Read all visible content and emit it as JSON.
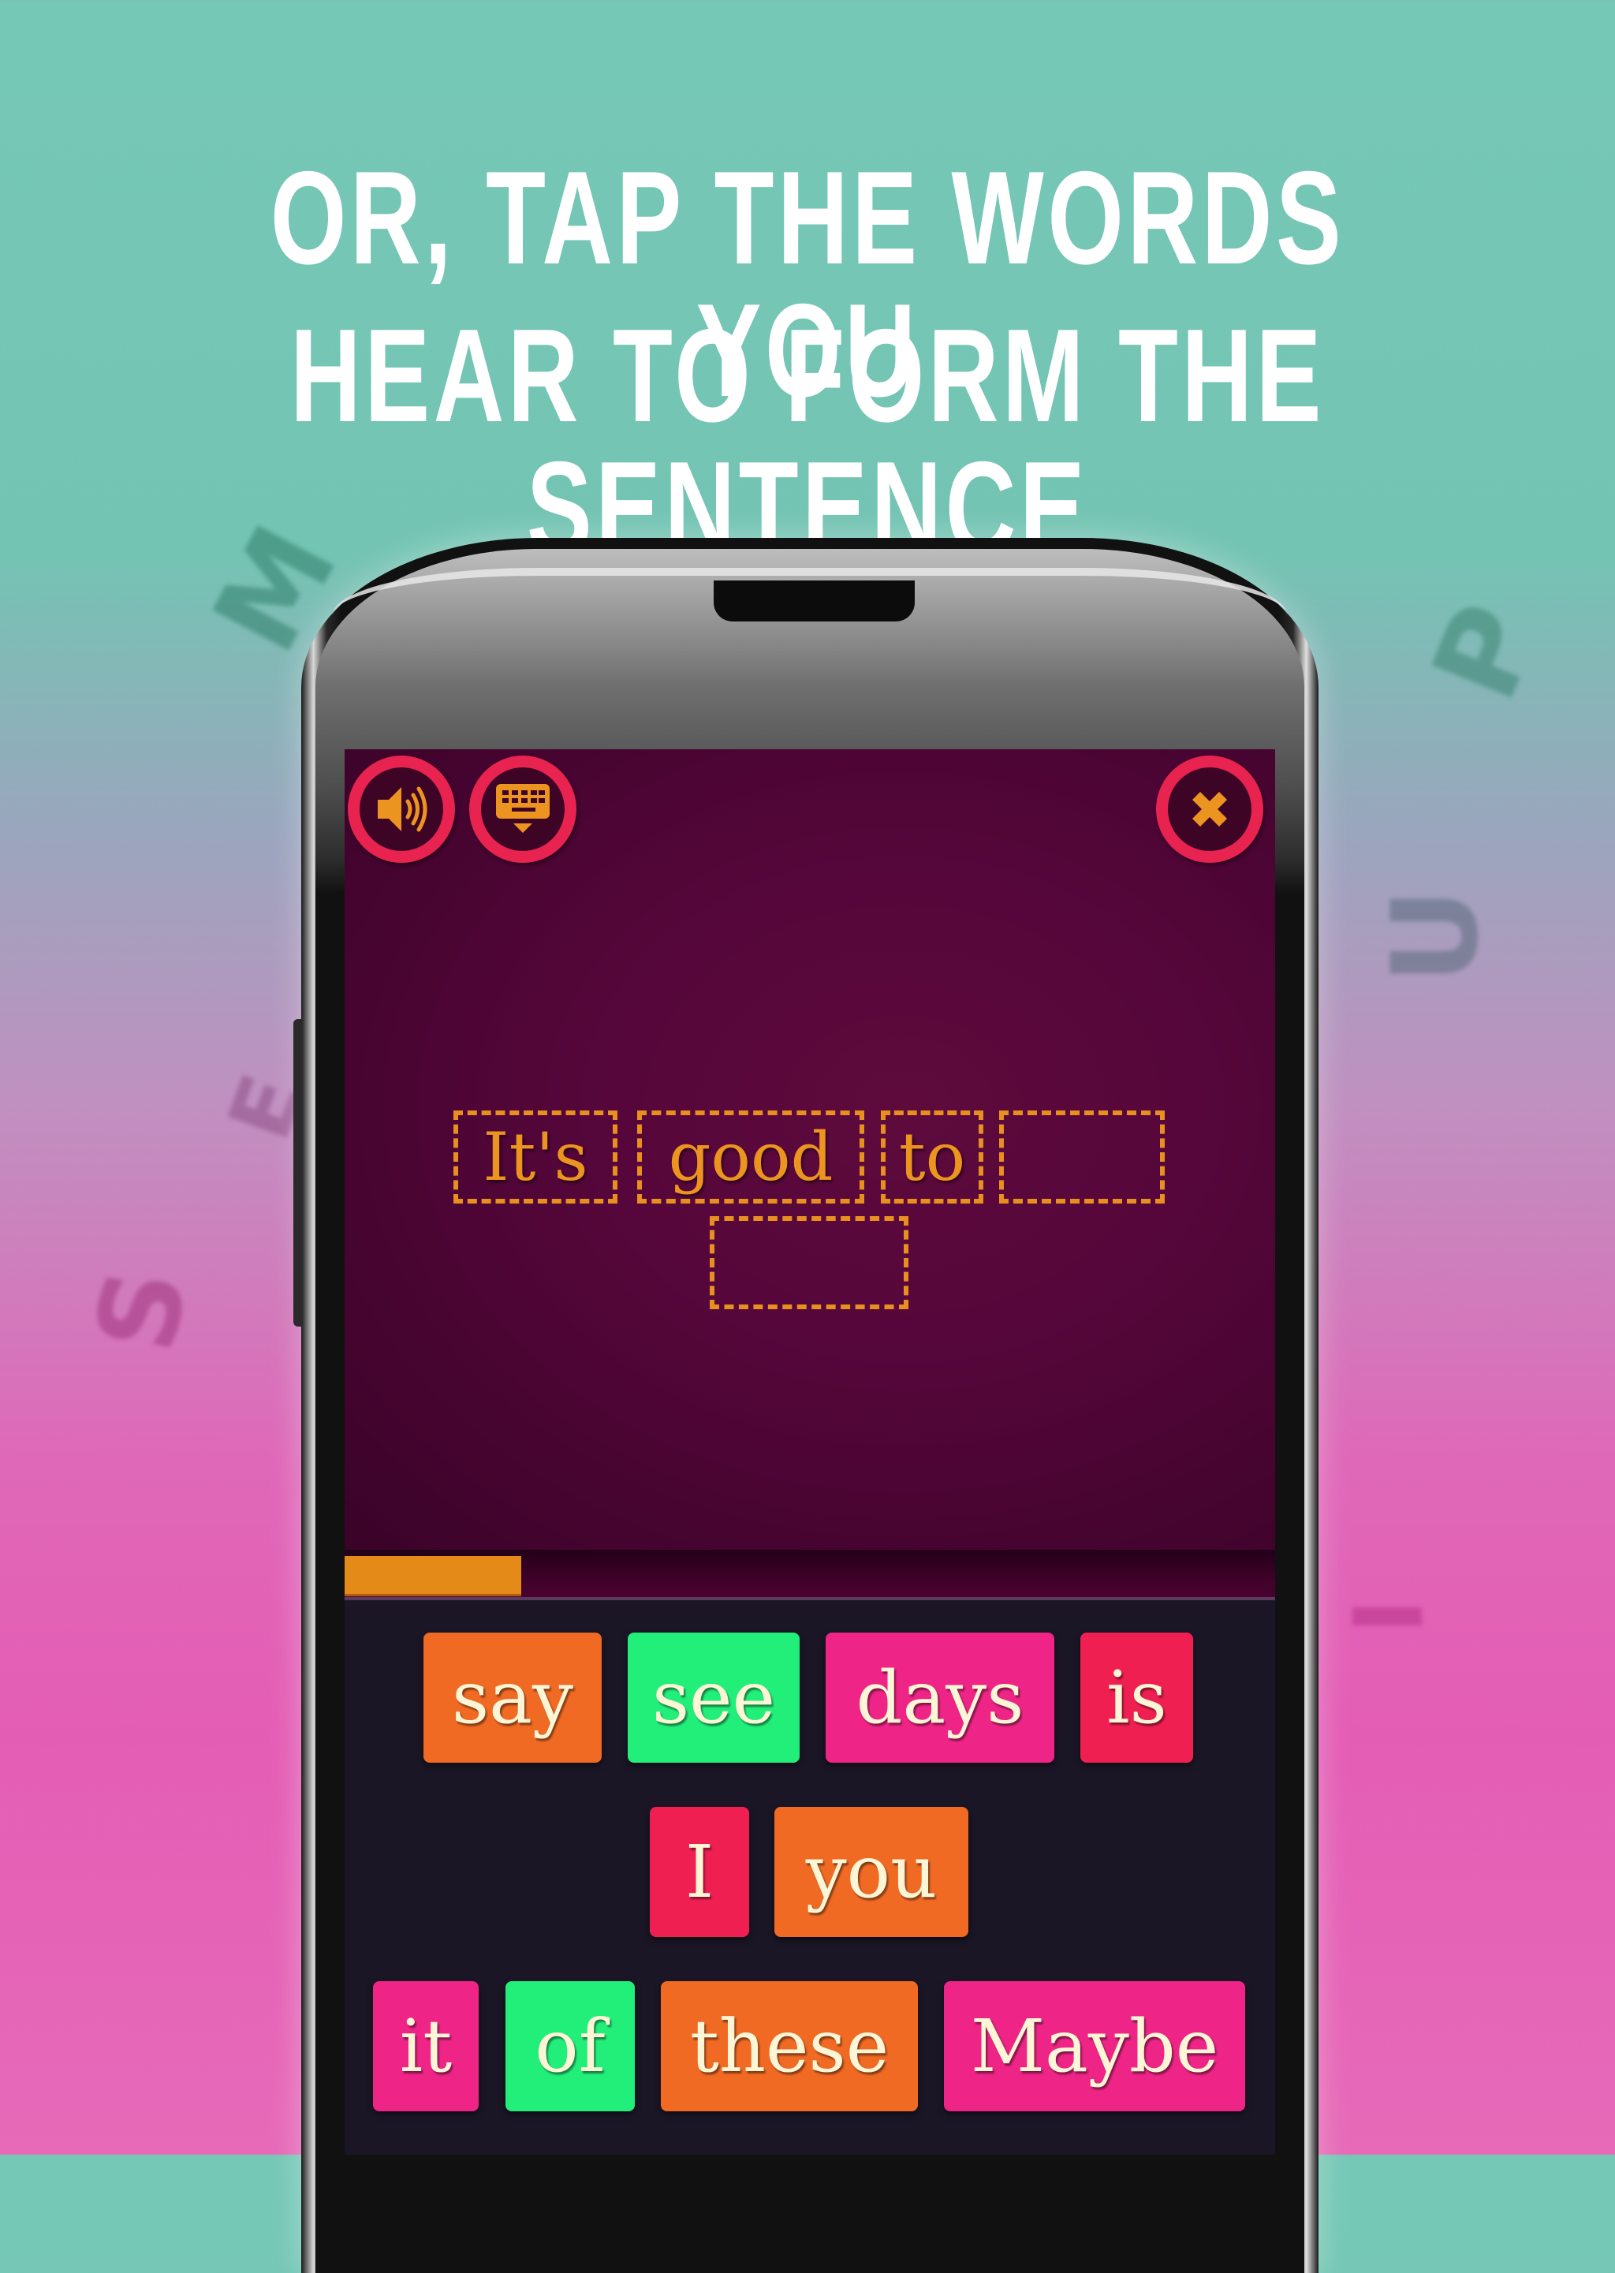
{
  "headline": {
    "line1": "OR, TAP THE WORDS YOU",
    "line2": "HEAR TO FORM THE SENTENCE"
  },
  "background_letters": [
    "M",
    "P",
    "U",
    "E",
    "S",
    "I"
  ],
  "toolbar": {
    "sound_icon": "speaker-icon",
    "keyboard_icon": "keyboard-icon",
    "close_icon": "close-x-icon"
  },
  "sentence_slots": [
    {
      "text": "It's",
      "filled": true
    },
    {
      "text": "good",
      "filled": true
    },
    {
      "text": "to",
      "filled": true
    },
    {
      "text": "",
      "filled": false
    },
    {
      "text": "",
      "filled": false
    }
  ],
  "progress": {
    "percent": 19
  },
  "word_tiles": [
    {
      "word": "say",
      "color": "#f06a24"
    },
    {
      "word": "see",
      "color": "#22ef7a"
    },
    {
      "word": "days",
      "color": "#ee2586"
    },
    {
      "word": "is",
      "color": "#ef1f52"
    },
    {
      "word": "I",
      "color": "#ef1f52"
    },
    {
      "word": "you",
      "color": "#f06a24"
    },
    {
      "word": "it",
      "color": "#ee2586"
    },
    {
      "word": "of",
      "color": "#22ef7a"
    },
    {
      "word": "these",
      "color": "#f06a24"
    },
    {
      "word": "Maybe",
      "color": "#ee2586"
    }
  ],
  "colors": {
    "accent_ring": "#e8234f",
    "accent_orange": "#e8901f",
    "game_bg": "#55063a",
    "tray_bg": "#1b1626",
    "tile_text": "#fdf6d6"
  }
}
